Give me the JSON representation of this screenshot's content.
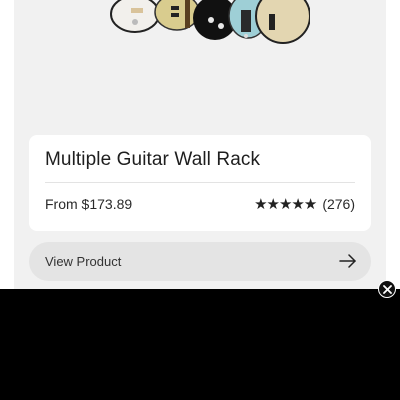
{
  "product": {
    "title": "Multiple Guitar Wall Rack",
    "price": "From $173.89",
    "stars": "★★★★★",
    "review_count": "(276)",
    "rating": 5
  },
  "actions": {
    "view_product_label": "View Product"
  },
  "icons": {
    "arrow": "arrow-right-icon",
    "close": "close-icon"
  },
  "colors": {
    "page_background": "#f1f1f1",
    "button_background": "#e4e4e4",
    "overlay": "#000000"
  }
}
